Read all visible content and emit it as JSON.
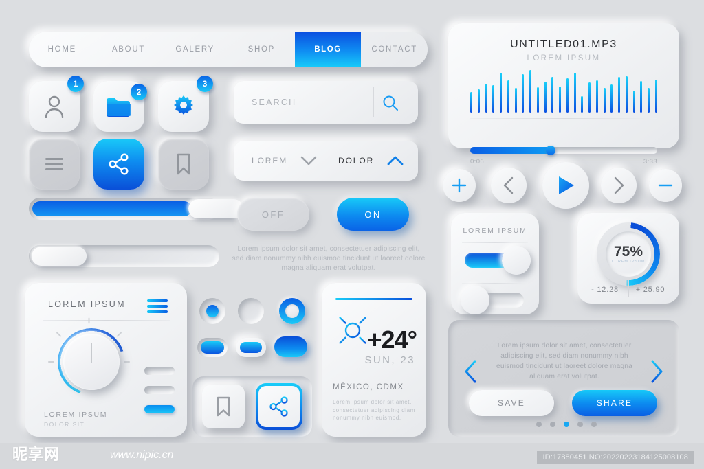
{
  "colors": {
    "bg": "#dcdee1",
    "accent_blue": "#0a5fe4",
    "accent_cyan": "#17c9f8",
    "text_dark": "#2d2f33",
    "text_muted": "#b0b4ba"
  },
  "nav": {
    "items": [
      {
        "label": "HOME",
        "active": false
      },
      {
        "label": "ABOUT",
        "active": false
      },
      {
        "label": "GALERY",
        "active": false
      },
      {
        "label": "SHOP",
        "active": false
      },
      {
        "label": "BLOG",
        "active": true
      },
      {
        "label": "CONTACT",
        "active": false
      }
    ]
  },
  "tiles": [
    {
      "icon": "user-icon",
      "badge": "1"
    },
    {
      "icon": "folder-icon",
      "badge": "2"
    },
    {
      "icon": "gear-icon",
      "badge": "3"
    },
    {
      "icon": "menu-icon",
      "badge": ""
    },
    {
      "icon": "share-icon",
      "badge": ""
    },
    {
      "icon": "bookmark-icon",
      "badge": ""
    }
  ],
  "search": {
    "placeholder": "SEARCH",
    "icon": "search-icon"
  },
  "dropdowns": [
    {
      "label": "LOREM",
      "icon": "chevron-down-icon",
      "state": "collapsed"
    },
    {
      "label": "DOLOR",
      "icon": "chevron-up-icon",
      "state": "expanded"
    }
  ],
  "toggle_buttons": {
    "off_label": "OFF",
    "on_label": "ON"
  },
  "paragraph": "Lorem ipsum dolor sit amet, consectetuer adipiscing elit, sed diam nonummy nibh euismod tincidunt ut laoreet dolore magna aliquam erat volutpat.",
  "sliders": {
    "top_value": 75,
    "bottom_value": 5
  },
  "knob_card": {
    "title": "LOREM IPSUM",
    "menu_icon": "hamburger-icon",
    "footer_title": "LOREM IPSUM",
    "footer_sub": "DOLOR SIT",
    "knob_value": 70,
    "mini_bars": [
      {
        "active": false
      },
      {
        "active": false
      },
      {
        "active": true
      }
    ]
  },
  "radios": [
    {
      "state": "selected-filled"
    },
    {
      "state": "empty"
    },
    {
      "state": "selected-ring"
    }
  ],
  "pills": [
    {
      "style": "inset"
    },
    {
      "style": "outline"
    },
    {
      "style": "raised"
    }
  ],
  "bookmark_share_group": [
    {
      "icon": "bookmark-icon",
      "active": false
    },
    {
      "icon": "share-icon",
      "active": true
    }
  ],
  "weather": {
    "icon": "sun-icon",
    "temperature": "+24°",
    "day": "SUN, 23",
    "city": "MÉXICO, CDMX",
    "description": "Lorem ipsum dolor sit amet, consectetuer adipiscing diam nonummy nibh euismod."
  },
  "player": {
    "title": "UNTITLED01.MP3",
    "subtitle": "LOREM IPSUM",
    "time_current": "0:06",
    "time_total": "3:33",
    "progress_percent": 43,
    "waveform": [
      30,
      34,
      42,
      40,
      58,
      47,
      36,
      56,
      62,
      37,
      45,
      52,
      38,
      50,
      58,
      24,
      44,
      47,
      36,
      41,
      52,
      53,
      32,
      46,
      36,
      48
    ]
  },
  "media_controls": [
    {
      "icon": "plus-icon",
      "size": "small",
      "accent": true
    },
    {
      "icon": "chevron-left-icon",
      "size": "small",
      "accent": false
    },
    {
      "icon": "play-icon",
      "size": "large",
      "accent": true
    },
    {
      "icon": "chevron-right-icon",
      "size": "small",
      "accent": false
    },
    {
      "icon": "minus-icon",
      "size": "small",
      "accent": true
    }
  ],
  "toggle_card": {
    "title": "LOREM IPSUM",
    "toggles": [
      {
        "state": "on"
      },
      {
        "state": "off"
      }
    ]
  },
  "percent_card": {
    "value": "75%",
    "sub_label": "LOREM IPSUM",
    "progress": 75,
    "left_stat": "- 12.28",
    "right_stat": "+ 25.90"
  },
  "carousel": {
    "text": "Lorem ipsum dolor sit amet, consectetuer adipiscing elit, sed diam nonummy nibh euismod tincidunt ut laoreet dolore magna aliquam erat volutpat.",
    "prev_icon": "chevron-left-icon",
    "next_icon": "chevron-right-icon",
    "save_label": "SAVE",
    "share_label": "SHARE",
    "dots": 5,
    "active_dot": 3
  },
  "watermark": {
    "logo": "昵享网",
    "url": "www.nipic.cn",
    "id_text": "ID:17880451 NO:20220223184125008108"
  }
}
